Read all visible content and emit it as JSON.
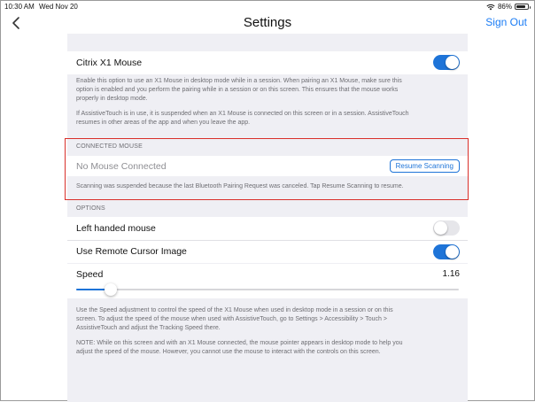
{
  "status_bar": {
    "time": "10:30 AM",
    "date": "Wed Nov 20",
    "battery": "86%",
    "battery_level": 0.86
  },
  "nav": {
    "title": "Settings",
    "sign_out": "Sign Out",
    "back_icon": "chevron-left-icon"
  },
  "mouse_toggle": {
    "label": "Citrix X1 Mouse",
    "enabled": true
  },
  "mouse_description": {
    "line1": "Enable this option to use an X1 Mouse in desktop mode while in a session. When pairing an X1 Mouse, make sure this",
    "line2": "option is enabled and you perform the pairing while in a session or on this screen. This ensures that the mouse works",
    "line3": "properly in desktop mode.",
    "line4": "If AssistiveTouch is in use, it is suspended when an X1 Mouse is connected on this screen or in a session. AssistiveTouch",
    "line5": "resumes in other areas of the app and when you leave the app."
  },
  "connected_mouse": {
    "header": "CONNECTED MOUSE",
    "status": "No Mouse Connected",
    "resume_button": "Resume Scanning",
    "note": "Scanning was suspended because the last Bluetooth Pairing Request was canceled. Tap Resume Scanning to resume."
  },
  "options": {
    "header": "OPTIONS",
    "left_handed": {
      "label": "Left handed mouse",
      "enabled": false
    },
    "remote_cursor": {
      "label": "Use Remote Cursor Image",
      "enabled": true
    },
    "speed": {
      "label": "Speed",
      "value": "1.16",
      "slider_fraction": 0.09
    }
  },
  "speed_description": {
    "line1": "Use the Speed adjustment to control the speed of the X1 Mouse when used in desktop mode in a session or on this",
    "line2": "screen. To adjust the speed of the mouse when used with AssistiveTouch, go to Settings > Accessibility > Touch >",
    "line3": "AssistiveTouch and adjust the Tracking Speed there.",
    "line4": "NOTE: While on this screen and with an X1 Mouse connected, the mouse pointer appears in desktop mode to help you",
    "line5": "adjust the speed of the mouse. However, you cannot use the mouse to interact with the controls on this screen."
  },
  "colors": {
    "accent": "#1e74d8",
    "highlight_border": "#d9302b",
    "grouped_background": "#efeff4"
  }
}
